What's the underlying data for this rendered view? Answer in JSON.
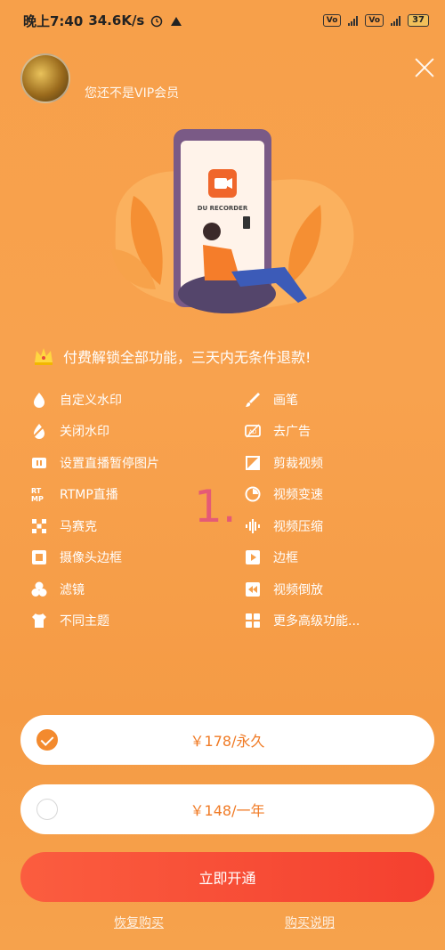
{
  "status_bar": {
    "time": "晚上7:40",
    "speed": "34.6K/s",
    "battery": "37"
  },
  "header": {
    "vip_status": "您还不是VIP会员"
  },
  "hero": {
    "app_label": "DU RECORDER"
  },
  "headline": "付费解锁全部功能，三天内无条件退款!",
  "features_left": [
    {
      "label": "自定义水印",
      "icon": "custom-watermark-icon"
    },
    {
      "label": "关闭水印",
      "icon": "remove-watermark-icon"
    },
    {
      "label": "设置直播暂停图片",
      "icon": "pause-image-icon"
    },
    {
      "label": "RTMP直播",
      "icon": "rtmp-icon"
    },
    {
      "label": "马赛克",
      "icon": "mosaic-icon"
    },
    {
      "label": "摄像头边框",
      "icon": "camera-frame-icon"
    },
    {
      "label": "滤镜",
      "icon": "filter-icon"
    },
    {
      "label": "不同主题",
      "icon": "theme-icon"
    }
  ],
  "features_right": [
    {
      "label": "画笔",
      "icon": "brush-icon"
    },
    {
      "label": "去广告",
      "icon": "no-ads-icon"
    },
    {
      "label": "剪裁视频",
      "icon": "crop-icon"
    },
    {
      "label": "视频变速",
      "icon": "speed-icon"
    },
    {
      "label": "视频压缩",
      "icon": "compress-icon"
    },
    {
      "label": "边框",
      "icon": "border-icon"
    },
    {
      "label": "视频倒放",
      "icon": "reverse-icon"
    },
    {
      "label": "更多高级功能...",
      "icon": "more-icon"
    }
  ],
  "overlay_number": "1.",
  "plans": [
    {
      "label": "￥178/永久",
      "selected": true
    },
    {
      "label": "￥148/一年",
      "selected": false
    }
  ],
  "cta_label": "立即开通",
  "links": {
    "restore": "恢复购买",
    "info": "购买说明"
  },
  "colors": {
    "background": "#f7a04a",
    "cta": "#f4402f",
    "accent": "#f38a2e"
  }
}
